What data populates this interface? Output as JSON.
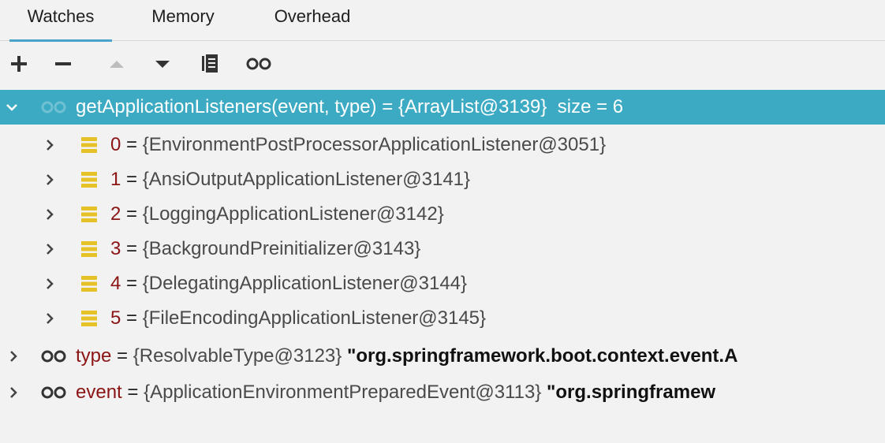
{
  "tabs": [
    {
      "label": "Watches",
      "active": true
    },
    {
      "label": "Memory",
      "active": false
    },
    {
      "label": "Overhead",
      "active": false
    }
  ],
  "toolbar": {
    "buttons": [
      {
        "name": "add",
        "icon": "plus-icon"
      },
      {
        "name": "remove",
        "icon": "minus-icon"
      },
      {
        "name": "move-up",
        "icon": "triangle-up-icon"
      },
      {
        "name": "move-down",
        "icon": "triangle-down-icon"
      },
      {
        "name": "copy",
        "icon": "copy-icon"
      },
      {
        "name": "show-watches",
        "icon": "glasses-icon"
      }
    ]
  },
  "colors": {
    "selection": "#3daac3",
    "tab_underline": "#4aa3c9",
    "key": "#8b1414",
    "list_icon": "#e6c229"
  },
  "tree": {
    "root": {
      "expression": "getApplicationListeners(event, type)",
      "equals": " = ",
      "value": "{ArrayList@3139}",
      "size_text": "size = 6"
    },
    "children": [
      {
        "key": "0",
        "equals": " = ",
        "value": "{EnvironmentPostProcessorApplicationListener@3051}"
      },
      {
        "key": "1",
        "equals": " = ",
        "value": "{AnsiOutputApplicationListener@3141}"
      },
      {
        "key": "2",
        "equals": " = ",
        "value": "{LoggingApplicationListener@3142}"
      },
      {
        "key": "3",
        "equals": " = ",
        "value": "{BackgroundPreinitializer@3143}"
      },
      {
        "key": "4",
        "equals": " = ",
        "value": "{DelegatingApplicationListener@3144}"
      },
      {
        "key": "5",
        "equals": " = ",
        "value": "{FileEncodingApplicationListener@3145}"
      }
    ],
    "watches": [
      {
        "key": "type",
        "equals": " = ",
        "value": "{ResolvableType@3123}",
        "string": "\"org.springframework.boot.context.event.A"
      },
      {
        "key": "event",
        "equals": " = ",
        "value": "{ApplicationEnvironmentPreparedEvent@3113}",
        "string": "\"org.springframew"
      }
    ]
  }
}
